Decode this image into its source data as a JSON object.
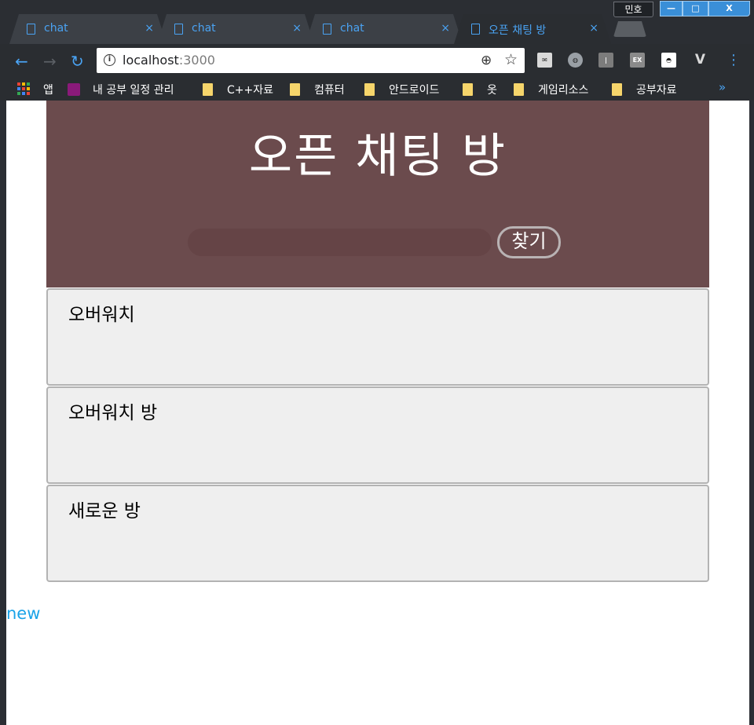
{
  "browser": {
    "user_label": "민호",
    "window_controls": {
      "minimize": "—",
      "maximize": "□",
      "close": "X"
    },
    "tabs": [
      {
        "label": "chat",
        "active": false
      },
      {
        "label": "chat",
        "active": false
      },
      {
        "label": "chat",
        "active": false
      },
      {
        "label": "오픈 채팅 방",
        "active": true
      }
    ],
    "close_glyph": "×",
    "nav": {
      "back": "←",
      "forward": "→",
      "reload": "↻"
    },
    "address": {
      "host": "localhost",
      "port": ":3000"
    },
    "omnibox_icons": {
      "info": "i",
      "zoom": "⊕",
      "star": "☆"
    },
    "extensions": [
      {
        "name": "mail-extension-icon",
        "label": "✉",
        "color": "#d9d9d9"
      },
      {
        "name": "globe-extension-icon",
        "label": "◍",
        "color": "#9aa0a6"
      },
      {
        "name": "bar-extension-icon",
        "label": "|",
        "color": "#7c7c7c"
      },
      {
        "name": "ex-extension-icon",
        "label": "EX",
        "color": "#8a8a8a"
      },
      {
        "name": "mask-extension-icon",
        "label": "◓",
        "color": "#ffffff"
      },
      {
        "name": "v-extension-icon",
        "label": "V",
        "color": "#2a2d31"
      }
    ],
    "menu_glyph": "⋮",
    "bookmarks": [
      {
        "label": "앱",
        "type": "apps"
      },
      {
        "label": "내 공부 일정 관리",
        "type": "trello"
      },
      {
        "label": "C++자료",
        "type": "folder"
      },
      {
        "label": "컴퓨터",
        "type": "folder"
      },
      {
        "label": "안드로이드",
        "type": "folder"
      },
      {
        "label": "옷",
        "type": "folder"
      },
      {
        "label": "게임리소스",
        "type": "folder"
      },
      {
        "label": "공부자료",
        "type": "folder"
      }
    ],
    "more_bookmarks": "»"
  },
  "page": {
    "title": "오픈 채팅 방",
    "search": {
      "value": "",
      "button_label": "찾기"
    },
    "rooms": [
      {
        "name": "오버워치"
      },
      {
        "name": "오버워치 방"
      },
      {
        "name": "새로운 방"
      }
    ],
    "new_link_label": "new"
  }
}
